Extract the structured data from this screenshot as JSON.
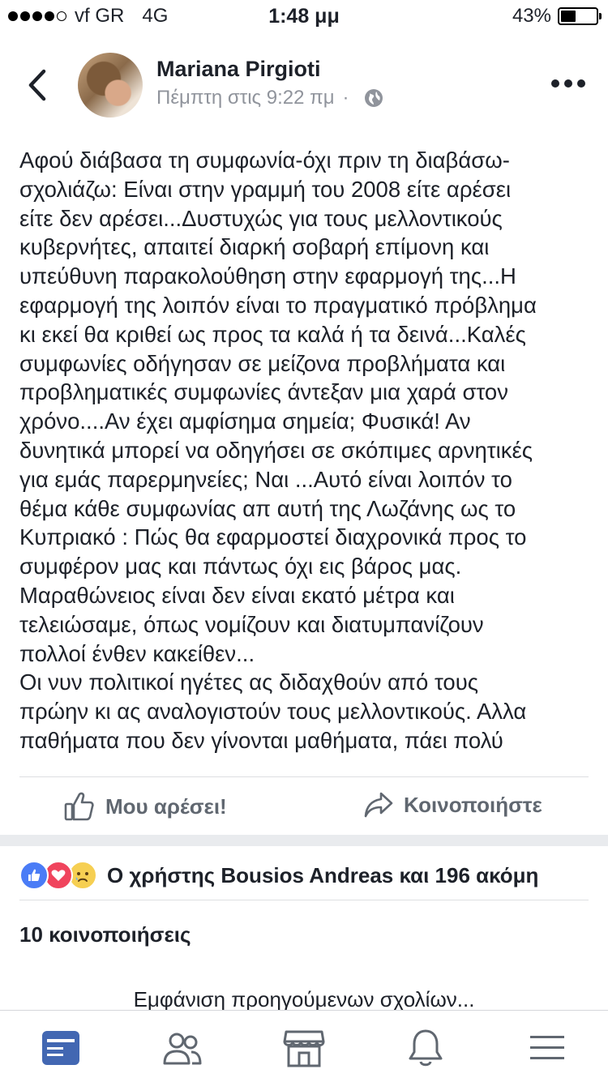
{
  "status_bar": {
    "carrier": "vf GR",
    "network": "4G",
    "time": "1:48 μμ",
    "battery": "43%",
    "battery_level": 0.43,
    "signal_bars": 4
  },
  "header": {
    "author": "Mariana Pirgioti",
    "timestamp": "Πέμπτη στις 9:22 πμ",
    "separator": "·",
    "privacy_icon": "globe-icon"
  },
  "post": {
    "lines": [
      "Αφού διάβασα τη συμφωνία-όχι πριν τη διαβάσω-",
      "σχολιάζω: Είναι στην γραμμή του 2008 είτε αρέσει",
      "είτε δεν αρέσει...Δυστυχώς για τους μελλοντικούς",
      "κυβερνήτες, απαιτεί διαρκή σοβαρή επίμονη και",
      "υπεύθυνη παρακολούθηση στην εφαρμογή της...Η",
      "εφαρμογή της λοιπόν είναι το πραγματικό πρόβλημα",
      "κι εκεί θα κριθεί ως προς τα καλά ή τα δεινά...Καλές",
      "συμφωνίες οδήγησαν σε μείζονα προβλήματα και",
      "προβληματικές συμφωνίες άντεξαν μια χαρά στον",
      "χρόνο....Αν έχει αμφίσημα σημεία; Φυσικά! Αν",
      "δυνητικά μπορεί να οδηγήσει σε σκόπιμες αρνητικές",
      "για εμάς παρερμηνείες; Ναι ...Αυτό είναι λοιπόν το",
      "θέμα κάθε συμφωνίας απ αυτή της Λωζάνης ως το",
      "Κυπριακό : Πώς θα εφαρμοστεί διαχρονικά προς το",
      "συμφέρον μας και πάντως όχι εις βάρος μας.",
      "Μαραθώνειος είναι δεν είναι εκατό μέτρα και",
      "τελειώσαμε,  όπως νομίζουν και διατυμπανίζουν",
      "πολλοί ένθεν κακείθεν...",
      "Οι νυν πολιτικοί  ηγέτες ας διδαχθούν από τους",
      "πρώην κι ας αναλογιστούν τους μελλοντικούς. Αλλα",
      "παθήματα που δεν γίνονται μαθήματα,  πάει πολύ"
    ]
  },
  "actions": {
    "like_label": "Μου αρέσει!",
    "share_label": "Κοινοποιήστε"
  },
  "reactions": {
    "text": "Ο χρήστης Bousios Andreas και 196 ακόμη",
    "icons": [
      "like-reaction-icon",
      "love-reaction-icon",
      "sad-reaction-icon"
    ]
  },
  "shares_label": "10 κοινοποιήσεις",
  "previous_comments_label": "Εμφάνιση προηγούμενων σχολίων...",
  "tabbar": {
    "tabs": [
      "news-feed-icon",
      "friends-icon",
      "marketplace-icon",
      "notifications-icon",
      "menu-icon"
    ],
    "active": "news-feed-icon"
  },
  "colors": {
    "accent": "#4267b2",
    "secondary_text": "#90949c",
    "action_text": "#606770",
    "divider": "#dddfe2"
  }
}
